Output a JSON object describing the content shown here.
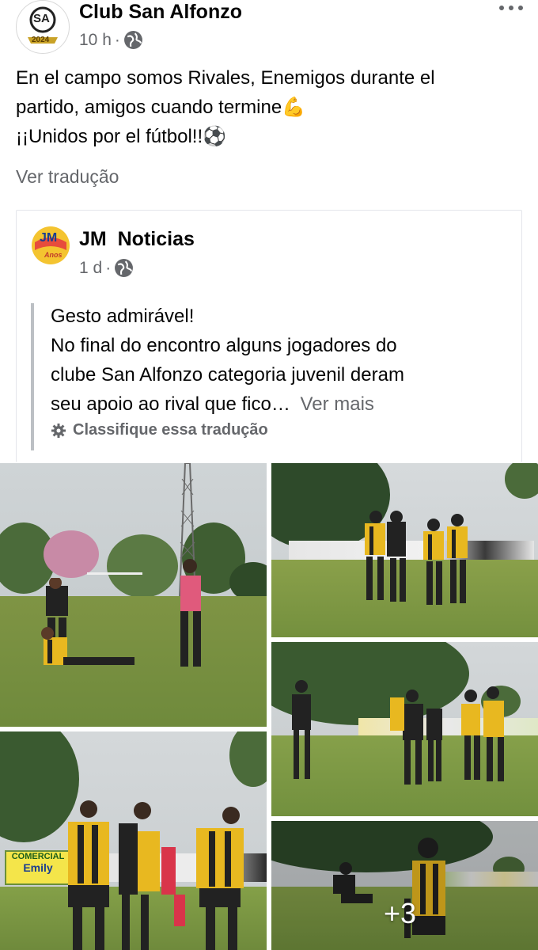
{
  "post": {
    "author": "Club San Alfonzo",
    "time": "10 h",
    "dot": "·",
    "text_line1": "En el campo somos Rivales, Enemigos durante el",
    "text_line2": "partido, amigos cuando termine💪",
    "text_line3": "¡¡Unidos por el fútbol!!⚽",
    "translate_link": "Ver tradução",
    "avatar_text": "SA",
    "avatar_year": "2024"
  },
  "shared": {
    "author": "JM  Noticias",
    "time": "1 d",
    "dot": "·",
    "avatar_text": "JM",
    "avatar_sub": "Anos",
    "line1": "Gesto admirável!",
    "line2": "No final do encontro alguns jogadores do",
    "line3": "clube San Alfonzo categoria juvenil deram",
    "line4": "seu apoio ao rival que fico…",
    "see_more": "Ver mais",
    "rate_translation": "Classifique essa tradução"
  },
  "photos": {
    "more_count": "+3",
    "banner1": "COMERCIAL",
    "banner1b": "Emily"
  },
  "colors": {
    "accent_gold": "#e8b820",
    "globe": "#65676b",
    "grass": "#6f8a3c",
    "sky": "#c9ced1"
  },
  "icons": {
    "more": "more-options-icon",
    "globe": "globe-icon",
    "gear": "gear-icon"
  }
}
